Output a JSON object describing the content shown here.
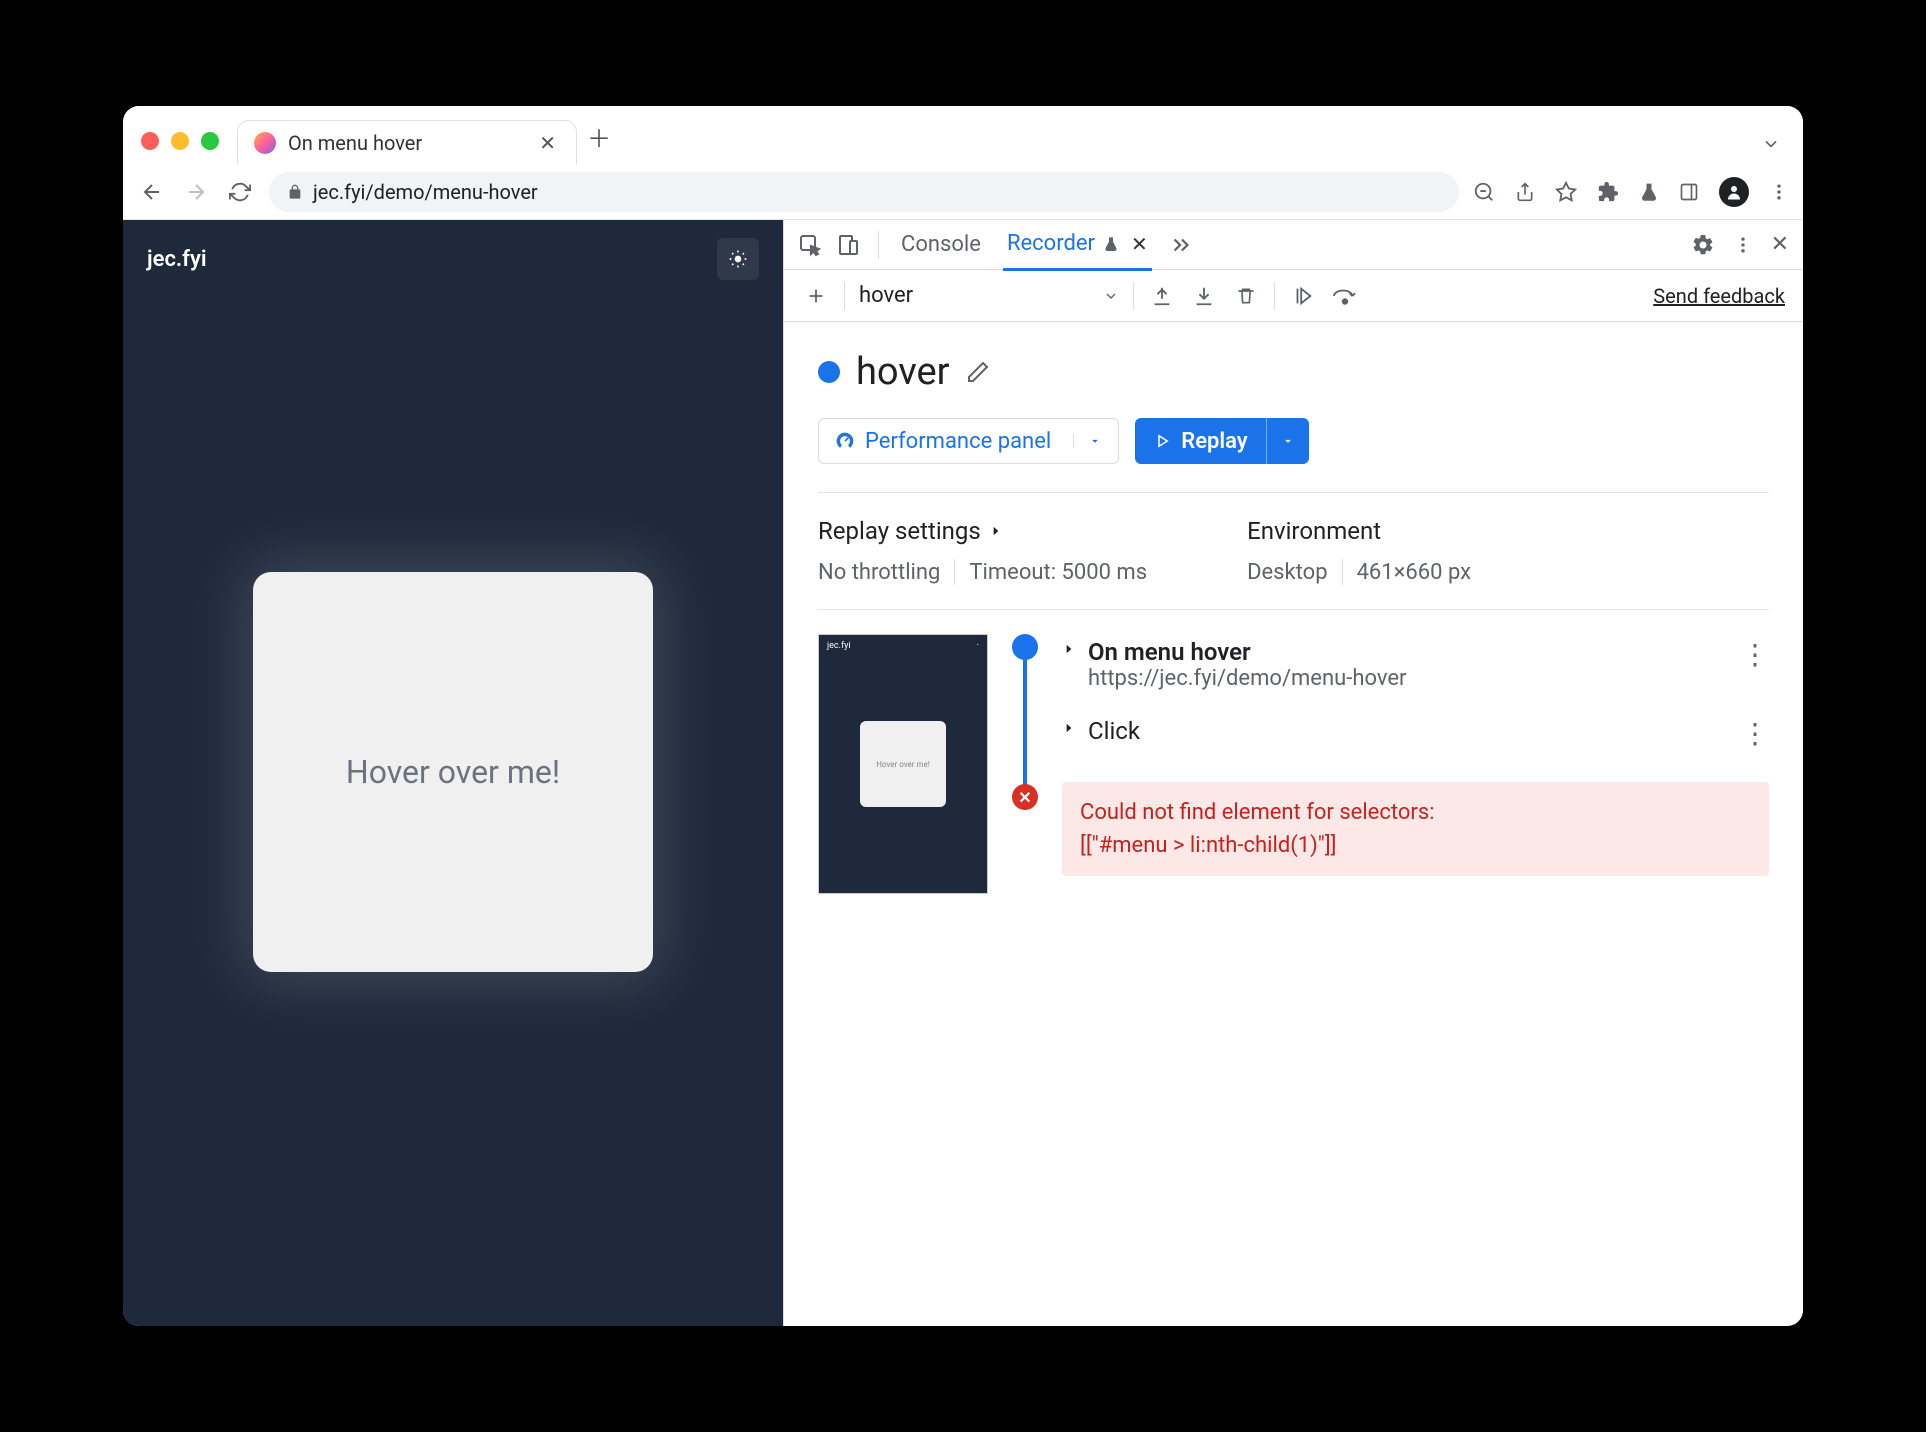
{
  "browser": {
    "tab_title": "On menu hover",
    "url": "jec.fyi/demo/menu-hover"
  },
  "page": {
    "logo": "jec.fyi",
    "hover_text": "Hover over me!"
  },
  "devtools": {
    "tabs": {
      "console": "Console",
      "recorder": "Recorder"
    },
    "toolbar": {
      "recording_name": "hover",
      "feedback": "Send feedback"
    },
    "recording": {
      "title": "hover",
      "perf_btn": "Performance panel",
      "replay_btn": "Replay"
    },
    "settings": {
      "replay_heading": "Replay settings",
      "throttling": "No throttling",
      "timeout": "Timeout: 5000 ms",
      "env_heading": "Environment",
      "device": "Desktop",
      "dimensions": "461×660 px"
    },
    "steps": {
      "nav_title": "On menu hover",
      "nav_url": "https://jec.fyi/demo/menu-hover",
      "click_label": "Click",
      "error_line1": "Could not find element for selectors:",
      "error_line2": "[[\"#menu > li:nth-child(1)\"]]"
    },
    "thumb": {
      "logo": "jec.fyi",
      "card": "Hover over me!"
    }
  }
}
